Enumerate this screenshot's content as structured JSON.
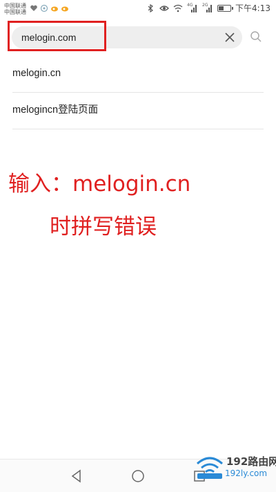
{
  "status_bar": {
    "carrier_1": "中国联通",
    "carrier_2": "中国联通",
    "network_1": "4G",
    "network_2": "2G",
    "time": "下午4:13"
  },
  "search": {
    "value": "melogin.com"
  },
  "suggestions": [
    {
      "label": "melogin.cn"
    },
    {
      "label": "melogincn登陆页面"
    }
  ],
  "annotation": {
    "line1": "输入：melogin.cn",
    "line2": "时拼写错误",
    "color": "#e02020"
  },
  "watermark": {
    "title": "192路由网",
    "url": "192ly.com"
  },
  "colors": {
    "highlight": "#e02020",
    "search_bg": "#eeeeee",
    "divider": "#e5e5e5"
  },
  "nav": {
    "back": "back-icon",
    "home": "home-icon",
    "recents": "recents-icon"
  }
}
